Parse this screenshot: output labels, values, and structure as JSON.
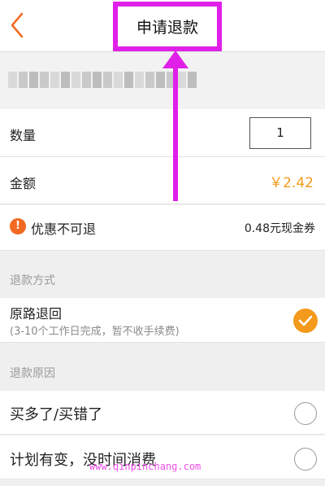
{
  "header": {
    "title": "申请退款",
    "back_icon": "chevron-left-icon"
  },
  "quantity": {
    "label": "数量",
    "value": "1"
  },
  "amount": {
    "label": "金额",
    "value": "￥2.42"
  },
  "discount": {
    "icon": "exclamation-icon",
    "label": "优惠不可退",
    "value": "0.48元现金券"
  },
  "refund_method": {
    "section_title": "退款方式",
    "option_title": "原路退回",
    "option_sub": "(3-10个工作日完成，暂不收手续费)",
    "selected": true
  },
  "refund_reason": {
    "section_title": "退款原因",
    "options": [
      "买多了/买错了",
      "计划有变，没时间消费"
    ]
  },
  "watermark": "www.qinpinchang.com",
  "colors": {
    "accent": "#f39a1c",
    "annotation": "#e020e8",
    "back": "#f26a21"
  }
}
